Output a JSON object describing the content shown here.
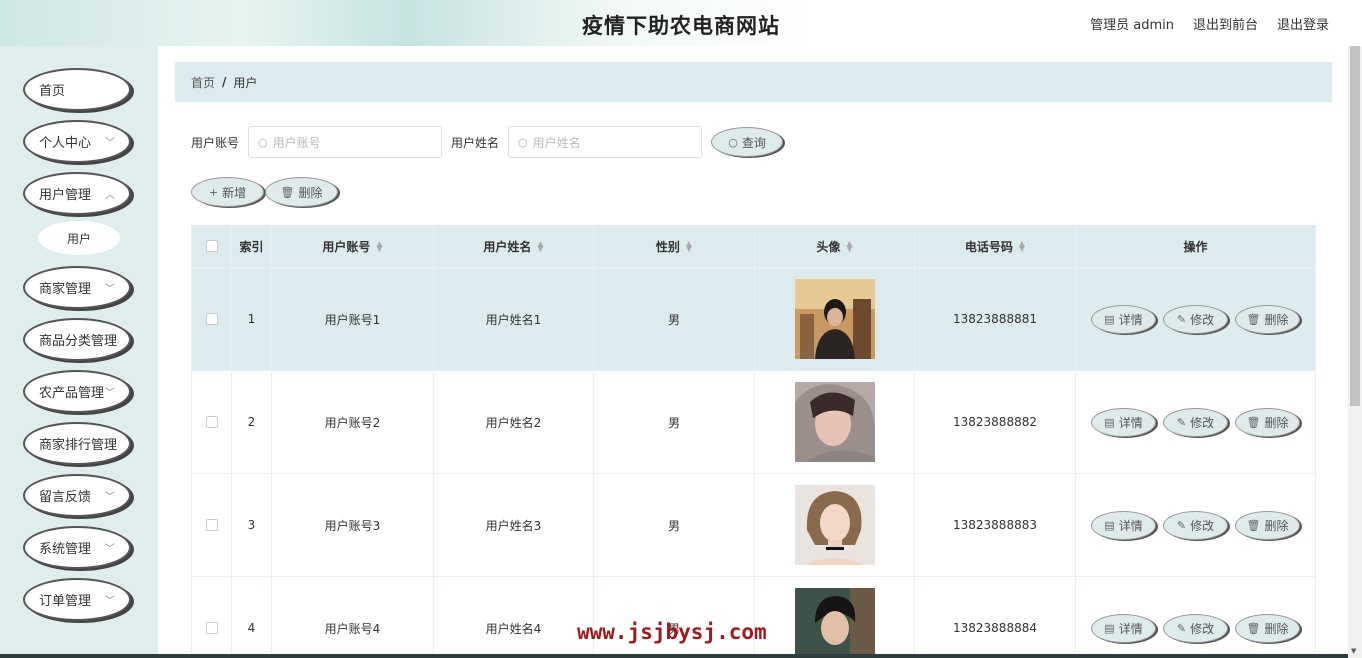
{
  "header": {
    "title": "疫情下助农电商网站",
    "admin_label": "管理员 admin",
    "back_front": "退出到前台",
    "logout": "退出登录"
  },
  "sidebar": {
    "items": [
      {
        "label": "首页",
        "has_chevron": false
      },
      {
        "label": "个人中心",
        "has_chevron": true
      },
      {
        "label": "用户管理",
        "has_chevron": true
      },
      {
        "label": "商家管理",
        "has_chevron": true
      },
      {
        "label": "商品分类管理",
        "has_chevron": false
      },
      {
        "label": "农产品管理",
        "has_chevron": true
      },
      {
        "label": "商家排行管理",
        "has_chevron": false
      },
      {
        "label": "留言反馈",
        "has_chevron": true
      },
      {
        "label": "系统管理",
        "has_chevron": true
      },
      {
        "label": "订单管理",
        "has_chevron": true
      }
    ],
    "sub_item": "用户"
  },
  "breadcrumb": {
    "home": "首页",
    "separator": "/",
    "current": "用户"
  },
  "search": {
    "account_label": "用户账号",
    "account_placeholder": "用户账号",
    "name_label": "用户姓名",
    "name_placeholder": "用户姓名",
    "query_button": "查询"
  },
  "actions": {
    "add": "新增",
    "delete": "删除"
  },
  "table": {
    "headers": [
      "索引",
      "用户账号",
      "用户姓名",
      "性别",
      "头像",
      "电话号码",
      "操作"
    ],
    "ops": {
      "detail": "详情",
      "edit": "修改",
      "delete": "删除"
    },
    "rows": [
      {
        "index": "1",
        "account": "用户账号1",
        "name": "用户姓名1",
        "gender": "男",
        "phone": "13823888881"
      },
      {
        "index": "2",
        "account": "用户账号2",
        "name": "用户姓名2",
        "gender": "男",
        "phone": "13823888882"
      },
      {
        "index": "3",
        "account": "用户账号3",
        "name": "用户姓名3",
        "gender": "男",
        "phone": "13823888883"
      },
      {
        "index": "4",
        "account": "用户账号4",
        "name": "用户姓名4",
        "gender": "男",
        "phone": "13823888884"
      }
    ]
  },
  "watermark": "www.jsjbysj.com",
  "colors": {
    "accent_bg": "#dcecee",
    "sidebar_bg": "#e0eded",
    "watermark": "#a2191c"
  }
}
